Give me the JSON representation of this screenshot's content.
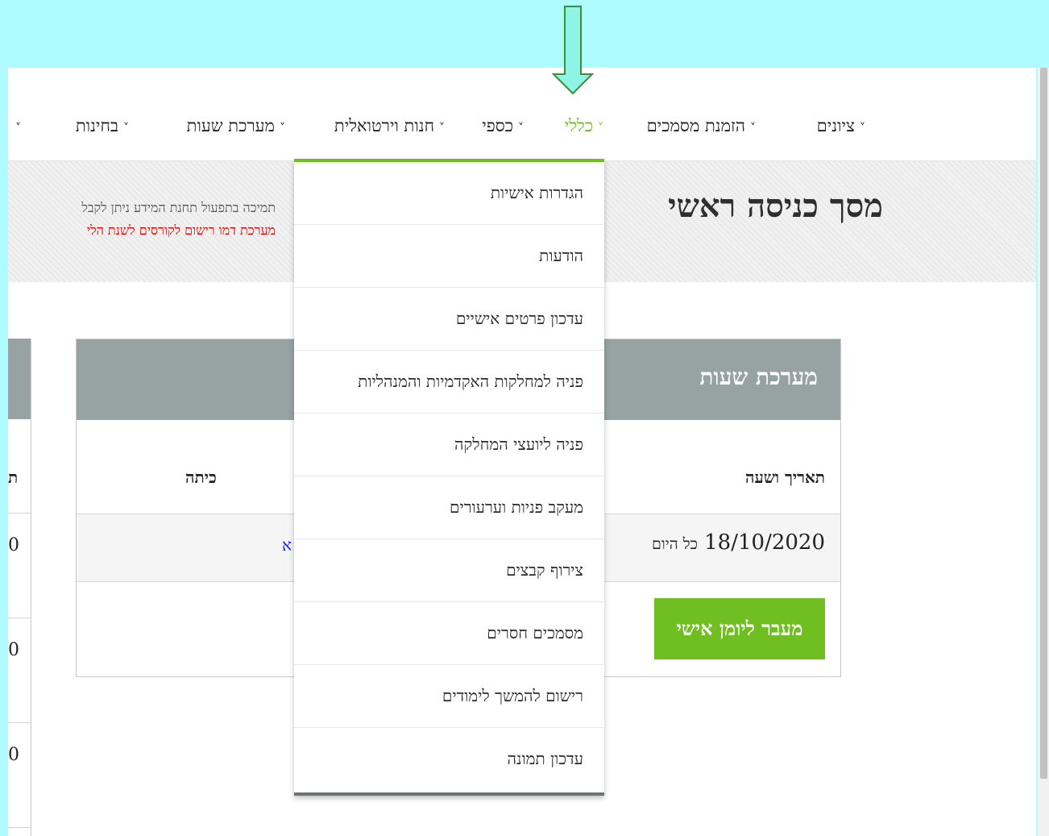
{
  "nav": {
    "items": [
      {
        "label": "ציונים",
        "active": false
      },
      {
        "label": "הזמנת מסמכים",
        "active": false
      },
      {
        "label": "כללי",
        "active": true
      },
      {
        "label": "כספי",
        "active": false
      },
      {
        "label": "חנות וירטואלית",
        "active": false
      },
      {
        "label": "מערכת שעות",
        "active": false
      },
      {
        "label": "בחינות",
        "active": false
      }
    ],
    "chevron": "˅"
  },
  "header": {
    "title": "מסך כניסה ראשי",
    "notice_line1": "תמיכה בתפעול תחנת המידע ניתן לקבל",
    "notice_line2": "מערכת דמו רישום לקורסים לשנת הלי"
  },
  "dropdown": {
    "items": [
      "הגדרות אישיות",
      "הודעות",
      "עדכון פרטים אישיים",
      "פניה למחלקות האקדמיות והמנהליות",
      "פניה ליועצי המחלקה",
      "מעקב פניות וערעורים",
      "צירוף קבצים",
      "מסמכים חסרים",
      "רישום להמשך לימודים",
      "עדכון תמונה"
    ]
  },
  "schedule": {
    "title": "מערכת שעות",
    "col_date": "תאריך ושעה",
    "col_class": "כיתה",
    "row_date": "18/10/2020",
    "row_time": "כל היום",
    "row_link": "א",
    "journal_button": "מעבר ליומן אישי"
  },
  "left_card": {
    "header_char": "ת",
    "values": [
      "0",
      "0",
      "0"
    ]
  },
  "colors": {
    "accent_green": "#6fbf22",
    "card_header": "#97a3a2",
    "alert_red": "#e00000",
    "frame_cyan": "#aefcff"
  }
}
